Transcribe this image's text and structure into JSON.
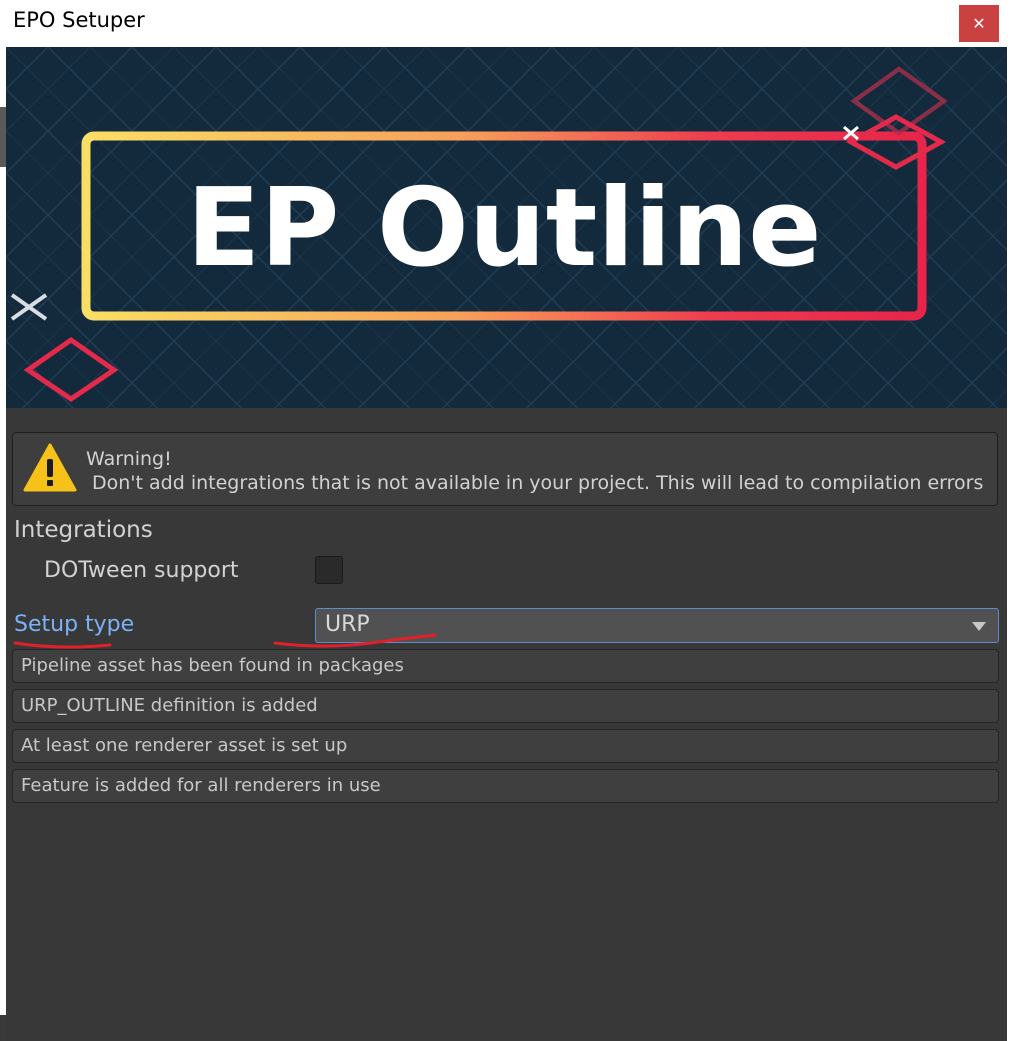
{
  "window": {
    "title": "EPO Setuper",
    "close_icon": "close-icon"
  },
  "banner": {
    "logo_text": "EP Outline"
  },
  "warning": {
    "title": "Warning!",
    "message": "Don't add integrations that is not available in your project. This will lead to compilation errors",
    "icon": "warning-icon"
  },
  "integrations": {
    "label": "Integrations",
    "dotween_label": "DOTween support",
    "dotween_checked": false
  },
  "setup": {
    "label": "Setup type",
    "selected": "URP"
  },
  "status_items": [
    "Pipeline asset has been found in packages",
    "URP_OUTLINE definition is added",
    "At least one renderer asset is set up",
    "Feature is added for all renderers in use"
  ],
  "colors": {
    "background": "#383838",
    "banner": "#132a3d",
    "link": "#7bb2f5",
    "annotation": "#e0202a"
  }
}
